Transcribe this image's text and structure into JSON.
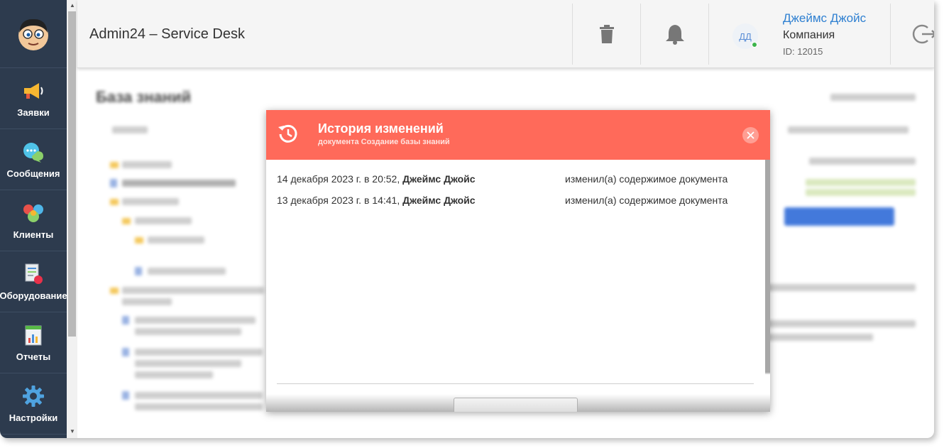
{
  "header": {
    "title": "Admin24 – Service Desk",
    "user": {
      "initials": "ДД",
      "name": "Джеймс Джойс",
      "company": "Компания",
      "id_label": "ID: 12015"
    },
    "icons": [
      "trash-icon",
      "bell-icon",
      "logout-icon"
    ]
  },
  "sidebar": {
    "items": [
      {
        "label": "Заявки",
        "icon": "megaphone-icon"
      },
      {
        "label": "Сообщения",
        "icon": "chat-icon"
      },
      {
        "label": "Клиенты",
        "icon": "clients-icon"
      },
      {
        "label": "Оборудование",
        "icon": "equipment-icon"
      },
      {
        "label": "Отчеты",
        "icon": "reports-icon"
      },
      {
        "label": "Настройки",
        "icon": "gear-icon"
      }
    ]
  },
  "background_page": {
    "title": "База знаний"
  },
  "modal": {
    "title": "История изменений",
    "subtitle": "документа Создание базы знаний",
    "rows": [
      {
        "date": "14 декабря 2023 г. в 20:52, ",
        "author": "Джеймс Джойс",
        "action": "изменил(а) содержимое документа"
      },
      {
        "date": "13 декабря 2023 г. в 14:41, ",
        "author": "Джеймс Джойс",
        "action": "изменил(а) содержимое документа"
      }
    ]
  },
  "colors": {
    "sidebar_bg": "#2d3b4e",
    "modal_header": "#ff6a5a",
    "user_link": "#2f80d1",
    "online": "#3cb44b"
  }
}
